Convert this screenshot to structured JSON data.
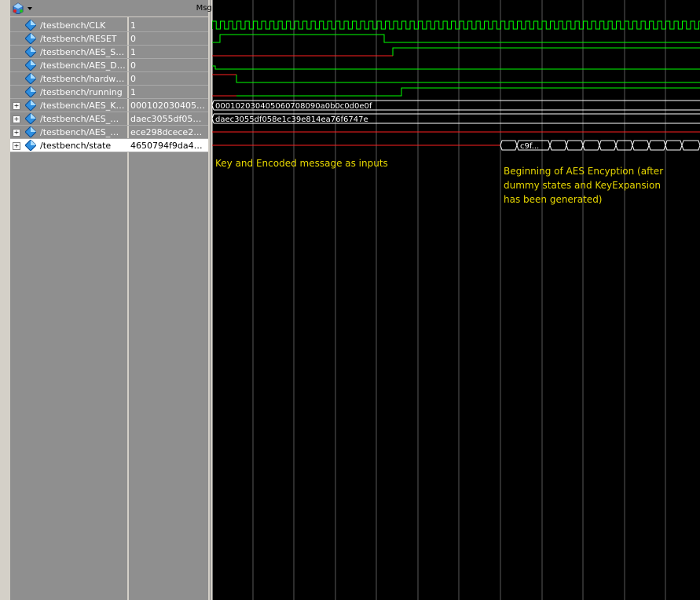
{
  "header": {
    "msgs_label": "Msgs"
  },
  "signals": [
    {
      "name": "/testbench/CLK",
      "value": "1",
      "expandable": false,
      "selected": false
    },
    {
      "name": "/testbench/RESET",
      "value": "0",
      "expandable": false,
      "selected": false
    },
    {
      "name": "/testbench/AES_ST...",
      "value": "1",
      "expandable": false,
      "selected": false
    },
    {
      "name": "/testbench/AES_DO...",
      "value": "0",
      "expandable": false,
      "selected": false
    },
    {
      "name": "/testbench/hardwar...",
      "value": "0",
      "expandable": false,
      "selected": false
    },
    {
      "name": "/testbench/running",
      "value": "1",
      "expandable": false,
      "selected": false
    },
    {
      "name": "/testbench/AES_KEY",
      "value": "00010203040506...",
      "expandable": true,
      "selected": false
    },
    {
      "name": "/testbench/AES_MS...",
      "value": "daec3055df058e...",
      "expandable": true,
      "selected": false
    },
    {
      "name": "/testbench/AES_MS...",
      "value": "ece298dcece298...",
      "expandable": true,
      "selected": false
    },
    {
      "name": "/testbench/state",
      "value": "4650794f9da4d1...",
      "expandable": true,
      "selected": true
    }
  ],
  "waves": {
    "key_label": "000102030405060708090a0b0c0d0e0f",
    "msg_label": "daec3055df058e1c39e814ea76f6747e",
    "state_first_label": "c9f...",
    "colors": {
      "green": "#00ff00",
      "red": "#ff2020",
      "grid": "#5a5a5a",
      "annot": "#e8d800"
    }
  },
  "annotations": {
    "inputs": "Key and Encoded message as inputs",
    "encryption": "Beginning of AES Encyption (after\ndummy states and KeyExpansion\nhas been generated)"
  }
}
